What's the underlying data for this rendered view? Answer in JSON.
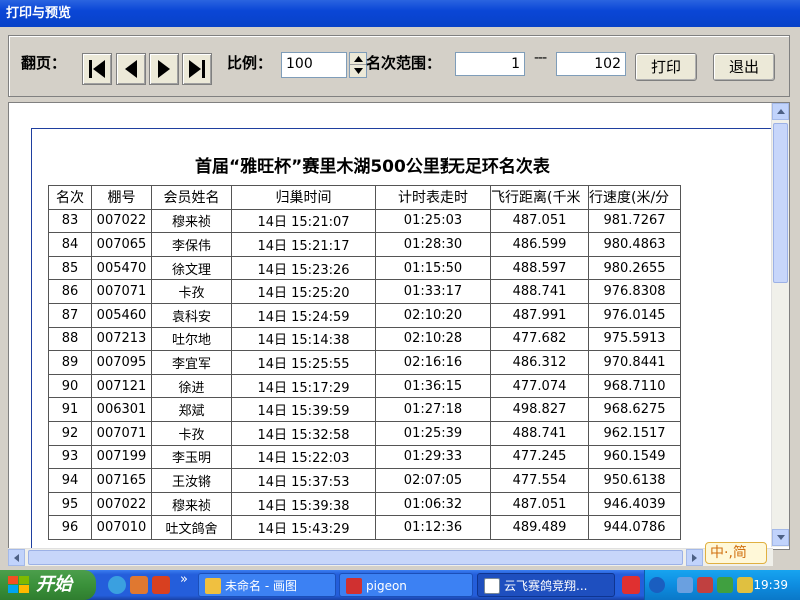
{
  "window": {
    "title": "打印与预览"
  },
  "toolbar": {
    "page_label": "翻页：",
    "scale_label": "比例：",
    "scale_value": "100",
    "range_label": "名次范围：",
    "range_from": "1",
    "range_sep": "---",
    "range_to": "102",
    "print_label": "打印",
    "exit_label": "退出"
  },
  "report": {
    "title": "首届“雅旺杯”赛里木湖500公里",
    "title_tail": "无足环名次表",
    "columns": [
      "名次",
      "棚号",
      "会员姓名",
      "归巢时间",
      "计时表走时",
      "飞行距离(千米",
      "行速度(米/分"
    ],
    "rows": [
      [
        "83",
        "007022",
        "穆来祯",
        "14日 15:21:07",
        "01:25:03",
        "487.051",
        "981.7267"
      ],
      [
        "84",
        "007065",
        "李保伟",
        "14日 15:21:17",
        "01:28:30",
        "486.599",
        "980.4863"
      ],
      [
        "85",
        "005470",
        "徐文理",
        "14日 15:23:26",
        "01:15:50",
        "488.597",
        "980.2655"
      ],
      [
        "86",
        "007071",
        "卡孜",
        "14日 15:25:20",
        "01:33:17",
        "488.741",
        "976.8308"
      ],
      [
        "87",
        "005460",
        "袁科安",
        "14日 15:24:59",
        "02:10:20",
        "487.991",
        "976.0145"
      ],
      [
        "88",
        "007213",
        "吐尔地",
        "14日 15:14:38",
        "02:10:28",
        "477.682",
        "975.5913"
      ],
      [
        "89",
        "007095",
        "李宜军",
        "14日 15:25:55",
        "02:16:16",
        "486.312",
        "970.8441"
      ],
      [
        "90",
        "007121",
        "徐进",
        "14日 15:17:29",
        "01:36:15",
        "477.074",
        "968.7110"
      ],
      [
        "91",
        "006301",
        "郑斌",
        "14日 15:39:59",
        "01:27:18",
        "498.827",
        "968.6275"
      ],
      [
        "92",
        "007071",
        "卡孜",
        "14日 15:32:58",
        "01:25:39",
        "488.741",
        "962.1517"
      ],
      [
        "93",
        "007199",
        "李玉明",
        "14日 15:22:03",
        "01:29:33",
        "477.245",
        "960.1549"
      ],
      [
        "94",
        "007165",
        "王汝锵",
        "14日 15:37:53",
        "02:07:05",
        "477.554",
        "950.6138"
      ],
      [
        "95",
        "007022",
        "穆来祯",
        "14日 15:39:38",
        "01:06:32",
        "487.051",
        "946.4039"
      ],
      [
        "96",
        "007010",
        "吐文鸽舍",
        "14日 15:43:29",
        "01:12:36",
        "489.489",
        "944.0786"
      ]
    ]
  },
  "ime": {
    "label": "中·,简"
  },
  "taskbar": {
    "start_label": "开始",
    "more_label": "»",
    "tasks": [
      "未命名 - 画图",
      "pigeon",
      "云飞赛鸽竞翔..."
    ],
    "clock": "19:39"
  }
}
